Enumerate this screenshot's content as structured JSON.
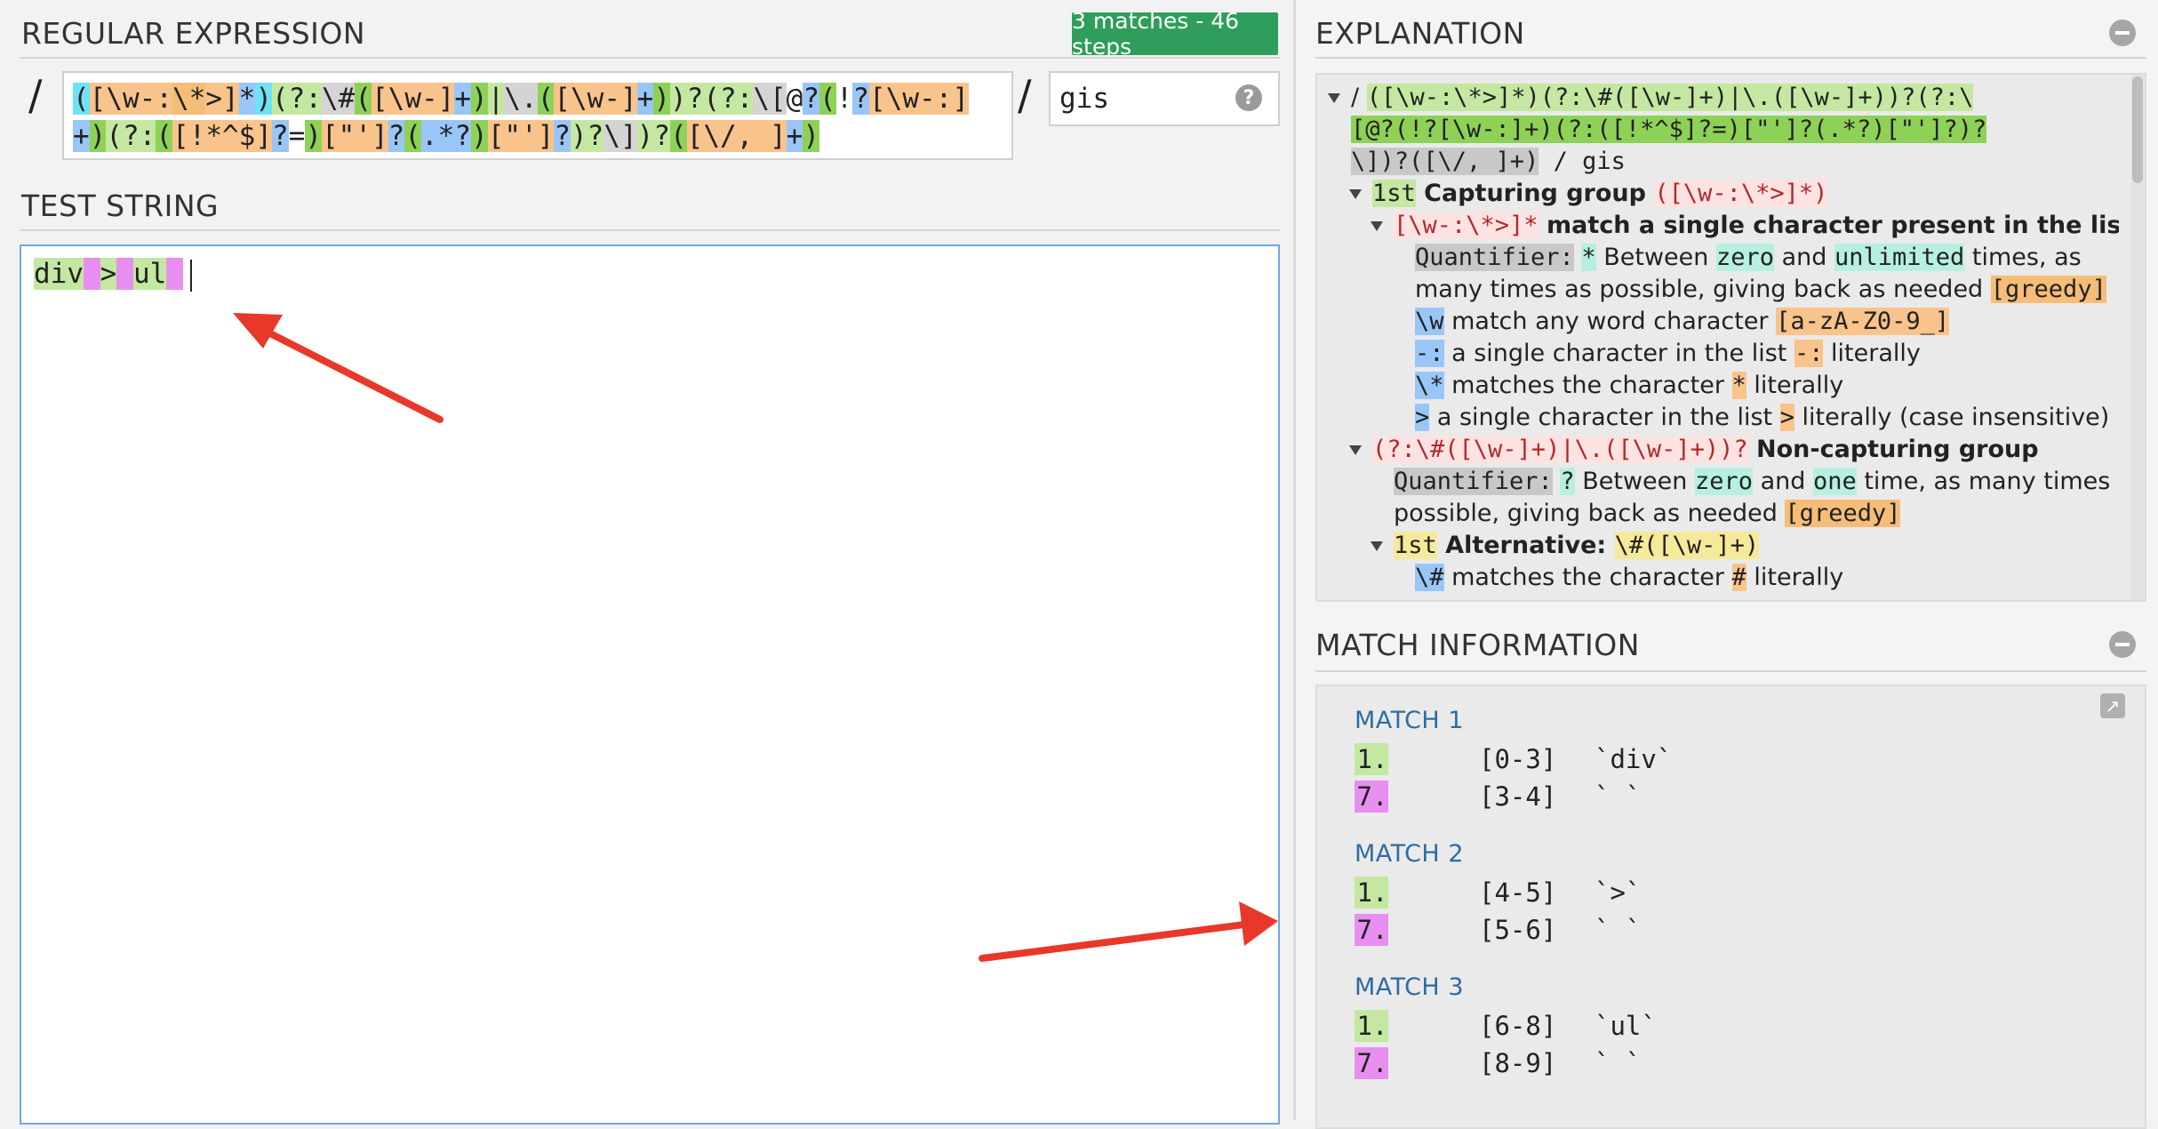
{
  "regex_panel": {
    "title": "REGULAR EXPRESSION",
    "badge": "3 matches - 46 steps",
    "delimiter_open": "/",
    "delimiter_close": "/",
    "pattern_line1_parts": [
      {
        "t": "(",
        "c": "hl-c"
      },
      {
        "t": "[\\w-:",
        "c": "hl-o"
      },
      {
        "t": "\\*",
        "c": "hl-od"
      },
      {
        "t": ">]",
        "c": "hl-o"
      },
      {
        "t": "*",
        "c": "hl-b"
      },
      {
        "t": ")",
        "c": "hl-c"
      },
      {
        "t": "(?:",
        "c": "hl-lg"
      },
      {
        "t": "\\#",
        "c": "hl-gy"
      },
      {
        "t": "(",
        "c": "hl-g"
      },
      {
        "t": "[\\w-]",
        "c": "hl-o"
      },
      {
        "t": "+",
        "c": "hl-b"
      },
      {
        "t": ")",
        "c": "hl-g"
      },
      {
        "t": "|",
        "c": "hl-lg"
      },
      {
        "t": "\\.",
        "c": "hl-gy"
      },
      {
        "t": "(",
        "c": "hl-g"
      },
      {
        "t": "[\\w-]",
        "c": "hl-o"
      },
      {
        "t": "+",
        "c": "hl-b"
      },
      {
        "t": ")",
        "c": "hl-g"
      },
      {
        "t": ")?",
        "c": "hl-lg"
      },
      {
        "t": "(?:",
        "c": "hl-lg"
      },
      {
        "t": "\\[",
        "c": "hl-gy"
      },
      {
        "t": "@",
        "c": ""
      },
      {
        "t": "?",
        "c": "hl-b"
      },
      {
        "t": "(",
        "c": "hl-g"
      },
      {
        "t": "!",
        "c": ""
      },
      {
        "t": "?",
        "c": "hl-b"
      },
      {
        "t": "[\\w-:]",
        "c": "hl-o"
      }
    ],
    "pattern_line2_parts": [
      {
        "t": "+",
        "c": "hl-b"
      },
      {
        "t": ")",
        "c": "hl-g"
      },
      {
        "t": "(?:",
        "c": "hl-lg"
      },
      {
        "t": "(",
        "c": "hl-g"
      },
      {
        "t": "[!*^$]",
        "c": "hl-o"
      },
      {
        "t": "?",
        "c": "hl-b"
      },
      {
        "t": "=",
        "c": ""
      },
      {
        "t": ")",
        "c": "hl-g"
      },
      {
        "t": "[\"']",
        "c": "hl-o"
      },
      {
        "t": "?",
        "c": "hl-b"
      },
      {
        "t": "(",
        "c": "hl-g"
      },
      {
        "t": ".*?",
        "c": "hl-b"
      },
      {
        "t": ")",
        "c": "hl-g"
      },
      {
        "t": "[\"']",
        "c": "hl-o"
      },
      {
        "t": "?",
        "c": "hl-b"
      },
      {
        "t": ")?",
        "c": "hl-lg"
      },
      {
        "t": "\\]",
        "c": "hl-gy"
      },
      {
        "t": ")?",
        "c": "hl-lg"
      },
      {
        "t": "(",
        "c": "hl-g"
      },
      {
        "t": "[\\/, ]",
        "c": "hl-o"
      },
      {
        "t": "+",
        "c": "hl-b"
      },
      {
        "t": ")",
        "c": "hl-g"
      }
    ],
    "flags": "gis",
    "help_icon": "question-circle-icon"
  },
  "test_panel": {
    "title": "TEST STRING",
    "string_parts": [
      {
        "t": "div",
        "c": "hl-lg"
      },
      {
        "t": " ",
        "c": "hl-p"
      },
      {
        "t": ">",
        "c": "hl-lg"
      },
      {
        "t": " ",
        "c": "hl-p"
      },
      {
        "t": "ul",
        "c": "hl-lg"
      },
      {
        "t": " ",
        "c": "hl-p"
      }
    ]
  },
  "explanation_panel": {
    "title": "EXPLANATION",
    "collapse_icon": "minus-circle-icon",
    "lines": [
      {
        "indent": 0,
        "tri": true,
        "parts": [
          {
            "t": "/ ",
            "c": ""
          },
          {
            "t": "([\\w-:\\*>]*)(?:\\#([\\w-]+)|\\.([\\w-]+))?(?:\\",
            "c": "hl-lg mono"
          }
        ]
      },
      {
        "indent": 0,
        "tri": false,
        "parts": [
          {
            "t": "[@?(!?[\\w-:]+)(?:([!*^$]?=)[\"']?(.*?)[\"']?)?",
            "c": "hl-g mono"
          }
        ]
      },
      {
        "indent": 0,
        "tri": false,
        "parts": [
          {
            "t": "\\])?([\\/, ]+)",
            "c": "hl-gr mono"
          },
          {
            "t": " / gis",
            "c": "mono"
          }
        ]
      },
      {
        "indent": 1,
        "tri": true,
        "parts": [
          {
            "t": "1st",
            "c": "hl-lg mono"
          },
          {
            "t": " Capturing group ",
            "c": "b"
          },
          {
            "t": "([\\w-:\\*>]*)",
            "c": "hl-r mono"
          }
        ]
      },
      {
        "indent": 2,
        "tri": true,
        "parts": [
          {
            "t": "[\\w-:\\*>]*",
            "c": "hl-r mono"
          },
          {
            "t": " match a single character present in the list below",
            "c": "b"
          }
        ]
      },
      {
        "indent": 3,
        "tri": false,
        "parts": [
          {
            "t": "Quantifier:",
            "c": "hl-gr mono"
          },
          {
            "t": " ",
            "c": ""
          },
          {
            "t": "*",
            "c": "hl-t mono"
          },
          {
            "t": " Between ",
            "c": ""
          },
          {
            "t": "zero",
            "c": "hl-t mono"
          },
          {
            "t": " and ",
            "c": ""
          },
          {
            "t": "unlimited",
            "c": "hl-t mono"
          },
          {
            "t": " times, as",
            "c": ""
          }
        ]
      },
      {
        "indent": 3,
        "tri": false,
        "parts": [
          {
            "t": "many times as possible, giving back as needed ",
            "c": ""
          },
          {
            "t": "[greedy]",
            "c": "hl-od mono"
          }
        ]
      },
      {
        "indent": 3,
        "tri": false,
        "parts": [
          {
            "t": "\\w",
            "c": "hl-b mono"
          },
          {
            "t": " match any word character ",
            "c": ""
          },
          {
            "t": "[a-zA-Z0-9_]",
            "c": "hl-o mono"
          }
        ]
      },
      {
        "indent": 3,
        "tri": false,
        "parts": [
          {
            "t": "-:",
            "c": "hl-b mono"
          },
          {
            "t": " a single character in the list ",
            "c": ""
          },
          {
            "t": "-:",
            "c": "hl-o mono"
          },
          {
            "t": " literally",
            "c": ""
          }
        ]
      },
      {
        "indent": 3,
        "tri": false,
        "parts": [
          {
            "t": "\\*",
            "c": "hl-b mono"
          },
          {
            "t": " matches the character ",
            "c": ""
          },
          {
            "t": "*",
            "c": "hl-o mono"
          },
          {
            "t": " literally",
            "c": ""
          }
        ]
      },
      {
        "indent": 3,
        "tri": false,
        "parts": [
          {
            "t": ">",
            "c": "hl-b mono"
          },
          {
            "t": " a single character in the list ",
            "c": ""
          },
          {
            "t": ">",
            "c": "hl-o mono"
          },
          {
            "t": " literally (case insensitive)",
            "c": ""
          }
        ]
      },
      {
        "indent": 1,
        "tri": true,
        "parts": [
          {
            "t": "(?:\\#([\\w-]+)|\\.([\\w-]+))?",
            "c": "hl-r mono"
          },
          {
            "t": " Non-capturing group",
            "c": "b"
          }
        ]
      },
      {
        "indent": 2,
        "tri": false,
        "parts": [
          {
            "t": "Quantifier:",
            "c": "hl-gr mono"
          },
          {
            "t": " ",
            "c": ""
          },
          {
            "t": "?",
            "c": "hl-t mono"
          },
          {
            "t": " Between ",
            "c": ""
          },
          {
            "t": "zero",
            "c": "hl-t mono"
          },
          {
            "t": " and ",
            "c": ""
          },
          {
            "t": "one",
            "c": "hl-t mono"
          },
          {
            "t": " time, as many times as",
            "c": ""
          }
        ]
      },
      {
        "indent": 2,
        "tri": false,
        "parts": [
          {
            "t": "possible, giving back as needed ",
            "c": ""
          },
          {
            "t": "[greedy]",
            "c": "hl-od mono"
          }
        ]
      },
      {
        "indent": 2,
        "tri": true,
        "parts": [
          {
            "t": "1st",
            "c": "hl-y mono"
          },
          {
            "t": " Alternative: ",
            "c": "b"
          },
          {
            "t": "\\#([\\w-]+)",
            "c": "hl-y mono"
          }
        ]
      },
      {
        "indent": 3,
        "tri": false,
        "parts": [
          {
            "t": "\\#",
            "c": "hl-b mono"
          },
          {
            "t": " matches the character ",
            "c": ""
          },
          {
            "t": "#",
            "c": "hl-o mono"
          },
          {
            "t": " literally",
            "c": ""
          }
        ]
      }
    ]
  },
  "match_panel": {
    "title": "MATCH INFORMATION",
    "collapse_icon": "minus-circle-icon",
    "external_icon": "external-link-icon",
    "matches": [
      {
        "title": "MATCH 1",
        "groups": [
          {
            "num": "1.",
            "c": "hl-lg",
            "range": "[0-3]",
            "value": "`div`"
          },
          {
            "num": "7.",
            "c": "hl-p",
            "range": "[3-4]",
            "value": "` `"
          }
        ]
      },
      {
        "title": "MATCH 2",
        "groups": [
          {
            "num": "1.",
            "c": "hl-lg",
            "range": "[4-5]",
            "value": "`>`"
          },
          {
            "num": "7.",
            "c": "hl-p",
            "range": "[5-6]",
            "value": "` `"
          }
        ]
      },
      {
        "title": "MATCH 3",
        "groups": [
          {
            "num": "1.",
            "c": "hl-lg",
            "range": "[6-8]",
            "value": "`ul`"
          },
          {
            "num": "7.",
            "c": "hl-p",
            "range": "[8-9]",
            "value": "` `"
          }
        ]
      }
    ]
  },
  "annotations": {
    "arrow_color": "#e8382a",
    "arrows": [
      "arrow-to-test-string",
      "arrow-to-match-information"
    ]
  }
}
